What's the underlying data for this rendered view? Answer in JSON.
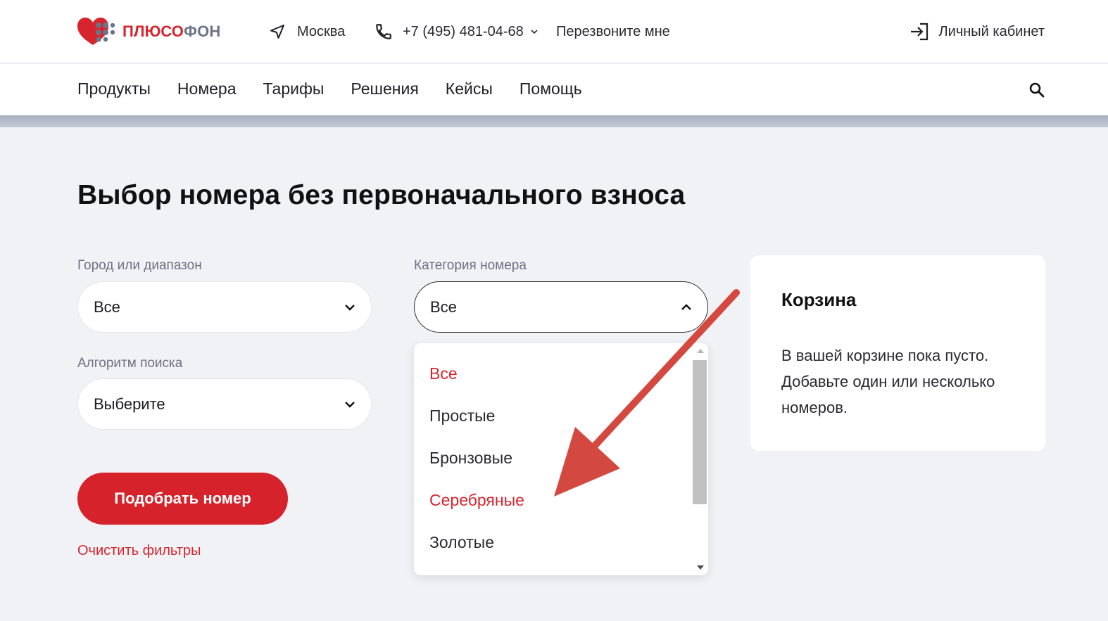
{
  "header": {
    "logo": {
      "part1": "ПЛЮСО",
      "part2": "ФОН",
      "brand_red": "#d6252d",
      "brand_gray": "#6b7389"
    },
    "city": "Москва",
    "phone": "+7 (495) 481-04-68",
    "callback_label": "Перезвоните мне",
    "account_label": "Личный кабинет"
  },
  "nav": {
    "items": [
      "Продукты",
      "Номера",
      "Тарифы",
      "Решения",
      "Кейсы",
      "Помощь"
    ]
  },
  "page": {
    "title": "Выбор номера без первоначального взноса"
  },
  "filters": {
    "city": {
      "label": "Город или диапазон",
      "value": "Все"
    },
    "category": {
      "label": "Категория номера",
      "value": "Все",
      "options": [
        "Все",
        "Простые",
        "Бронзовые",
        "Серебряные",
        "Золотые"
      ],
      "highlighted": [
        "Все",
        "Серебряные"
      ]
    },
    "algorithm": {
      "label": "Алгоритм поиска",
      "value": "Выберите"
    },
    "submit_label": "Подобрать номер",
    "clear_label": "Очистить фильтры"
  },
  "cart": {
    "title": "Корзина",
    "empty_text": "В вашей корзине пока пусто. Добавьте один или несколько номеров."
  },
  "colors": {
    "accent": "#d6232b",
    "background": "#f1f2f6",
    "annotation_arrow": "#d4493f"
  }
}
